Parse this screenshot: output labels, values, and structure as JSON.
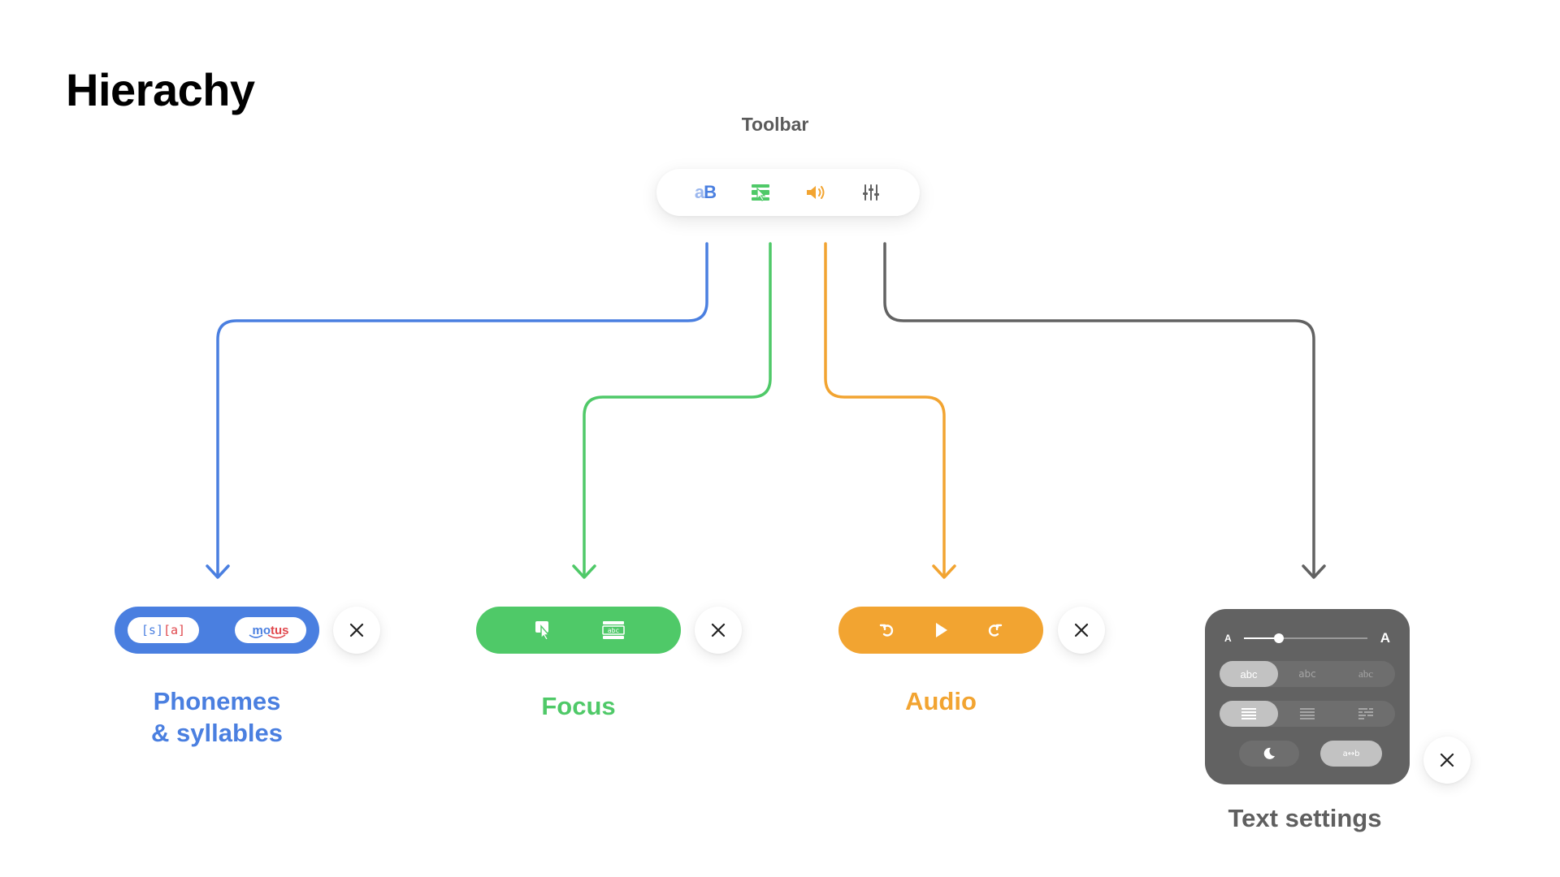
{
  "page": {
    "title": "Hierachy"
  },
  "toolbar": {
    "label": "Toolbar",
    "items": [
      {
        "name": "phonemes-syllables",
        "icon": "aB-text-icon",
        "text_a": "a",
        "text_b": "B",
        "color": "#4a7fe0"
      },
      {
        "name": "focus",
        "icon": "focus-ruler-icon",
        "color": "#4fc968"
      },
      {
        "name": "audio",
        "icon": "speaker-icon",
        "color": "#f2a431"
      },
      {
        "name": "text-settings",
        "icon": "sliders-icon",
        "color": "#626262"
      }
    ]
  },
  "panels": {
    "phonemes": {
      "label_line1": "Phonemes",
      "label_line2": "& syllables",
      "color": "#4a7fe0",
      "phoneme_chip": {
        "part1": "[s]",
        "part2": "[a]"
      },
      "syllable_chip": {
        "part1": "mo",
        "part2": "tus"
      }
    },
    "focus": {
      "label": "Focus",
      "color": "#4fc968",
      "ruler_text": "abc"
    },
    "audio": {
      "label": "Audio",
      "color": "#f2a431"
    },
    "text_settings": {
      "label": "Text settings",
      "color": "#626262",
      "slider": {
        "min_label": "A",
        "max_label": "A",
        "value": 0.28
      },
      "font_options": [
        "abc",
        "abc",
        "abc"
      ],
      "font_selected": 0,
      "align_selected": 0,
      "spacing_label": "a↔b"
    }
  },
  "icons": {
    "close": "close-icon",
    "rewind": "rewind-icon",
    "play": "play-icon",
    "forward": "forward-icon",
    "moon": "moon-icon"
  }
}
